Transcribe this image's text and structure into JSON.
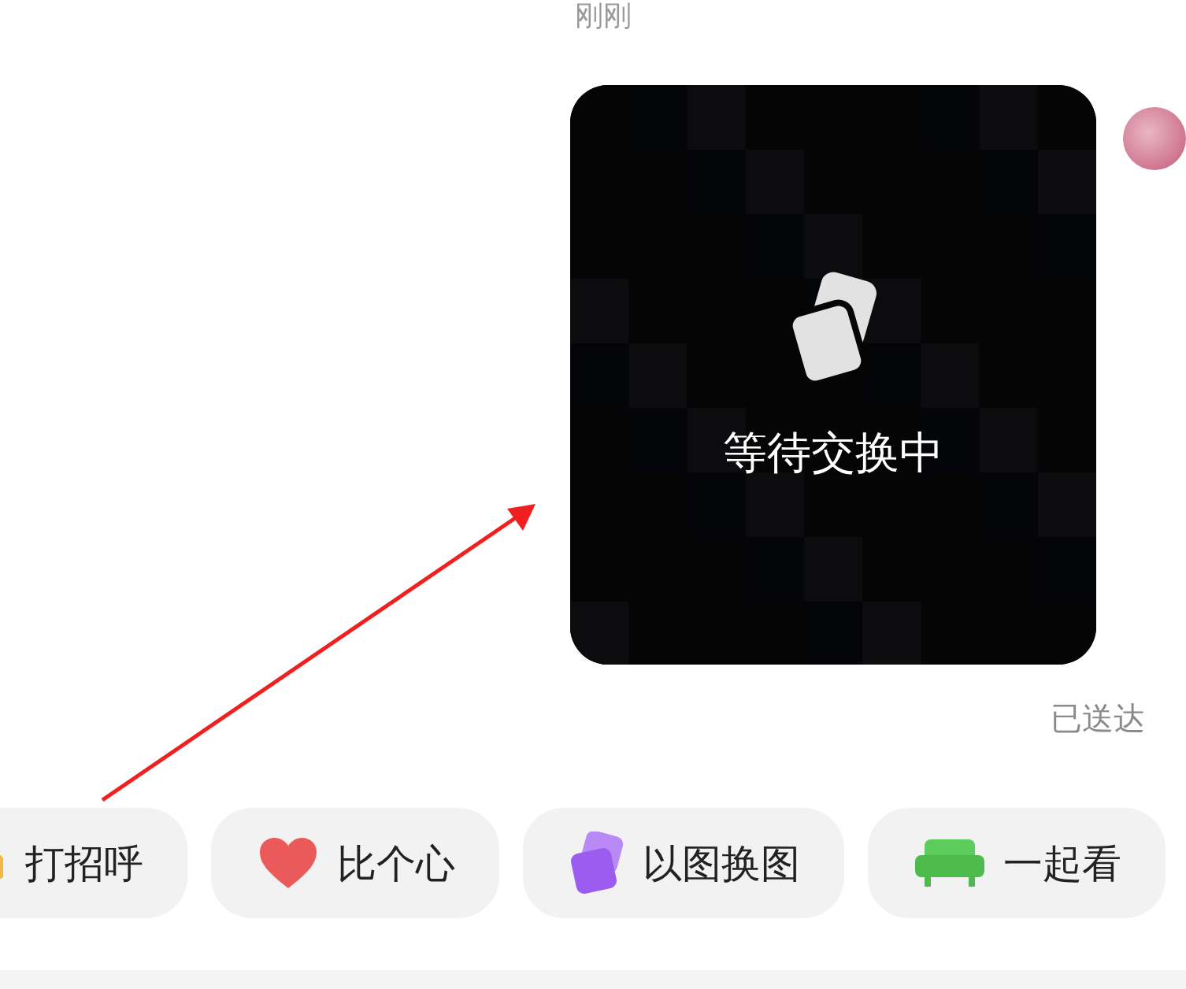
{
  "timestamp": "刚刚",
  "message": {
    "kind": "picture-swap",
    "status_text": "等待交换中",
    "delivery": "已送达"
  },
  "quick_replies": [
    {
      "kind": "wave",
      "label": "打招呼"
    },
    {
      "kind": "heart",
      "label": "比个心"
    },
    {
      "kind": "swap",
      "label": "以图换图"
    },
    {
      "kind": "sofa",
      "label": "一起看"
    }
  ]
}
